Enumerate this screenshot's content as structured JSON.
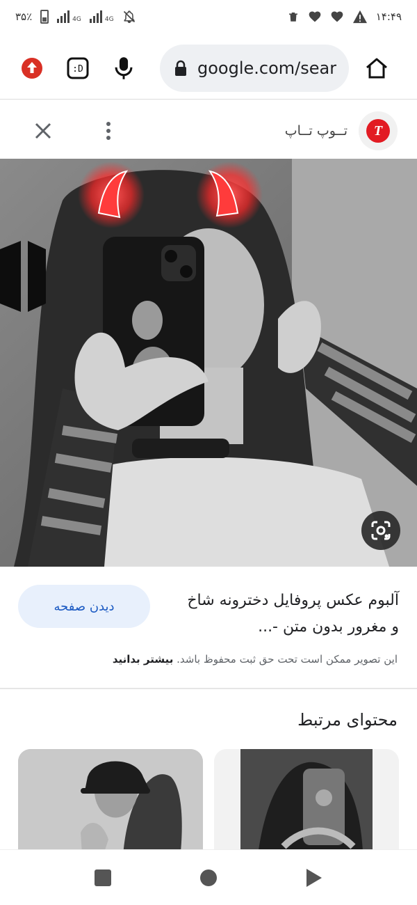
{
  "status_bar": {
    "battery_text": "۳۵٪",
    "network_1": "4G",
    "network_2": "4G",
    "time": "۱۴:۴۹",
    "icons": [
      "battery-icon",
      "signal-icon",
      "signal-icon",
      "mute-bell-icon",
      "trash-notification-icon",
      "heart-icon",
      "heart-icon",
      "warning-icon"
    ]
  },
  "browser": {
    "url": "google.com/sear",
    "icons": [
      "upload-icon",
      "emoji-face-icon",
      "microphone-icon",
      "lock-icon",
      "home-icon"
    ]
  },
  "site_header": {
    "site_name": "تــوپ تــاپ",
    "logo_letter": "T",
    "icons": [
      "close-icon",
      "more-vert-icon"
    ]
  },
  "image_result": {
    "title": "آلبوم عکس پروفایل دخترونه شاخ و مغرور بدون متن -...",
    "visit_button": "دیدن صفحه",
    "copyright_notice": "این تصویر ممکن است تحت حق ثبت محفوظ باشد.",
    "learn_more": "بیشتر بدانید",
    "overlay_text": "۸ ۸",
    "lens_icon": "google-lens-icon"
  },
  "related": {
    "title": "محتوای مرتبط"
  },
  "nav_bar": {
    "icons": [
      "recents-square-icon",
      "home-circle-icon",
      "back-triangle-icon"
    ]
  },
  "colors": {
    "accent_blue": "#1a59c2",
    "visit_button_bg": "#e8f0fc",
    "upload_red": "#d93025",
    "logo_red": "#e21b23",
    "devil_horn_red": "#ff2a2a"
  }
}
